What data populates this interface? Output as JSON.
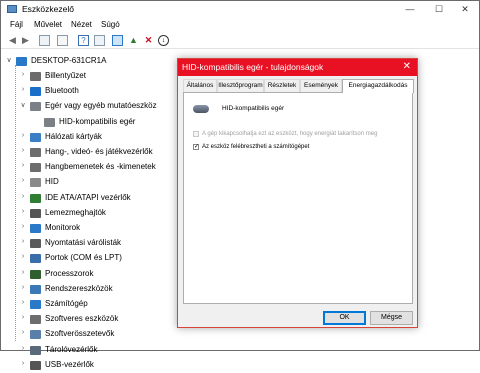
{
  "window": {
    "title": "Eszközkezelő",
    "minimize": "—",
    "maximize": "☐",
    "close": "✕"
  },
  "menu": [
    "Fájl",
    "Művelet",
    "Nézet",
    "Súgó"
  ],
  "toolbar": [
    "back-icon",
    "forward-icon",
    "properties-icon",
    "list-icon",
    "help-icon",
    "view-icon",
    "monitor-icon",
    "update-icon",
    "remove-icon",
    "download-icon"
  ],
  "tree": {
    "root": {
      "label": "DESKTOP-631CR1A",
      "expander": "∨"
    },
    "items": [
      {
        "label": "Billentyűzet",
        "expander": "›",
        "icon": "keyboard-icon",
        "color": "#6b6b6b"
      },
      {
        "label": "Bluetooth",
        "expander": "›",
        "icon": "bluetooth-icon",
        "color": "#1a6fc9"
      },
      {
        "label": "Egér vagy egyéb mutatóeszköz",
        "expander": "∨",
        "icon": "mouse-icon",
        "color": "#7b7f86"
      },
      {
        "label": "HID-kompatibilis egér",
        "expander": "",
        "icon": "mouse-icon",
        "color": "#7b7f86",
        "child": true
      },
      {
        "label": "Hálózati kártyák",
        "expander": "›",
        "icon": "network-icon",
        "color": "#3a7fc3"
      },
      {
        "label": "Hang-, videó- és játékvezérlők",
        "expander": "›",
        "icon": "sound-icon",
        "color": "#6d6d6d"
      },
      {
        "label": "Hangbemenetek és -kimenetek",
        "expander": "›",
        "icon": "audio-icon",
        "color": "#6d6d6d"
      },
      {
        "label": "HID",
        "expander": "›",
        "icon": "hid-icon",
        "color": "#8a8a8a"
      },
      {
        "label": "IDE ATA/ATAPI vezérlők",
        "expander": "›",
        "icon": "ide-icon",
        "color": "#2e7d32"
      },
      {
        "label": "Lemezmeghajtók",
        "expander": "›",
        "icon": "disk-icon",
        "color": "#555555"
      },
      {
        "label": "Monitorok",
        "expander": "›",
        "icon": "monitor-icon",
        "color": "#2a78c8"
      },
      {
        "label": "Nyomtatási várólisták",
        "expander": "›",
        "icon": "printer-icon",
        "color": "#5a5a5a"
      },
      {
        "label": "Portok (COM és LPT)",
        "expander": "›",
        "icon": "port-icon",
        "color": "#3b6ea8"
      },
      {
        "label": "Processzorok",
        "expander": "›",
        "icon": "cpu-icon",
        "color": "#2f5f2f"
      },
      {
        "label": "Rendszereszközök",
        "expander": "›",
        "icon": "system-icon",
        "color": "#3a78b8"
      },
      {
        "label": "Számítógép",
        "expander": "›",
        "icon": "computer-icon",
        "color": "#2a78c8"
      },
      {
        "label": "Szoftveres eszközök",
        "expander": "›",
        "icon": "software-icon",
        "color": "#6d6d6d"
      },
      {
        "label": "Szoftverösszetevők",
        "expander": "›",
        "icon": "component-icon",
        "color": "#5a7fa8"
      },
      {
        "label": "Tárolóvezérlők",
        "expander": "›",
        "icon": "storage-icon",
        "color": "#5a6a7a"
      },
      {
        "label": "USB-vezérlők",
        "expander": "›",
        "icon": "usb-icon",
        "color": "#555555"
      }
    ]
  },
  "dialog": {
    "title": "HID-kompatibilis egér - tulajdonságok",
    "close": "✕",
    "tabs": [
      "Általános",
      "Illesztőprogram",
      "Részletek",
      "Események",
      "Energiagazdálkodás"
    ],
    "active_tab": 4,
    "device_name": "HID-kompatibilis egér",
    "option1": {
      "label": "A gép kikapcsolhatja ezt az eszközt, hogy energiát takarítson meg",
      "checked": false,
      "enabled": false
    },
    "option2": {
      "label": "Az eszköz felébresztheti a számítógépet",
      "checked": true,
      "enabled": true
    },
    "ok": "OK",
    "cancel": "Mégse"
  }
}
